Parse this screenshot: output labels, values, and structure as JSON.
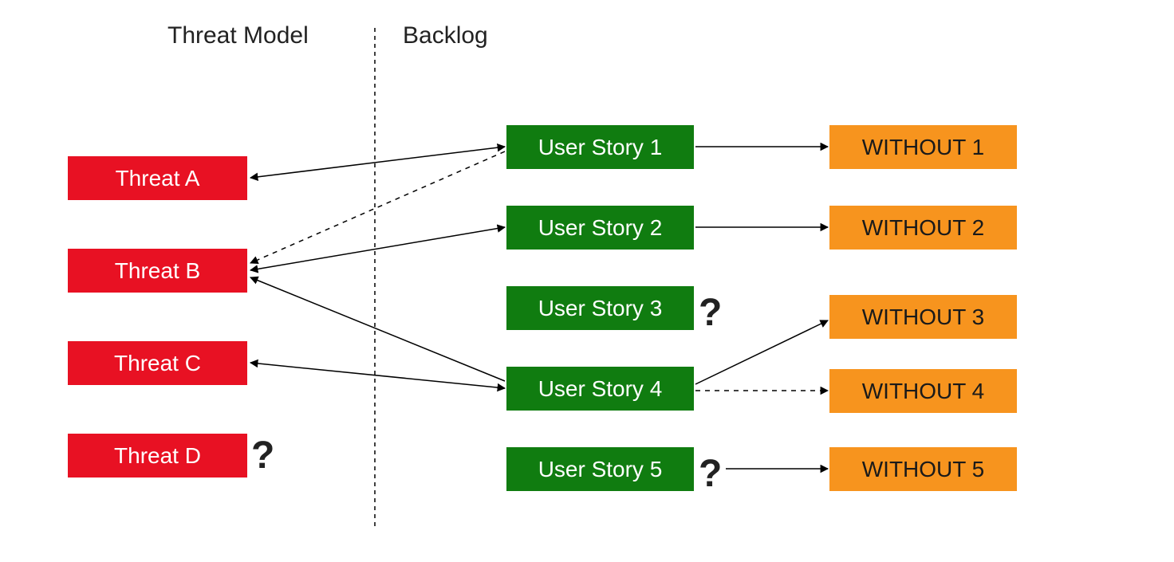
{
  "headings": {
    "threat_model": "Threat Model",
    "backlog": "Backlog"
  },
  "threats": {
    "a": "Threat A",
    "b": "Threat B",
    "c": "Threat C",
    "d": "Threat D"
  },
  "stories": {
    "s1": "User Story 1",
    "s2": "User Story 2",
    "s3": "User Story 3",
    "s4": "User Story 4",
    "s5": "User Story 5"
  },
  "withouts": {
    "w1": "WITHOUT 1",
    "w2": "WITHOUT 2",
    "w3": "WITHOUT 3",
    "w4": "WITHOUT 4",
    "w5": "WITHOUT 5"
  },
  "question_mark": "?",
  "colors": {
    "threat": "#E81123",
    "story": "#107C10",
    "without": "#F7941E"
  },
  "connections": [
    {
      "from": "story1",
      "to": "threatA",
      "style": "solid",
      "dir": "both"
    },
    {
      "from": "story1",
      "to": "threatB",
      "style": "dashed",
      "dir": "to"
    },
    {
      "from": "story2",
      "to": "threatB",
      "style": "solid",
      "dir": "both"
    },
    {
      "from": "story4",
      "to": "threatB",
      "style": "solid",
      "dir": "to"
    },
    {
      "from": "story4",
      "to": "threatC",
      "style": "solid",
      "dir": "both"
    },
    {
      "from": "story1",
      "to": "without1",
      "style": "solid",
      "dir": "to"
    },
    {
      "from": "story2",
      "to": "without2",
      "style": "solid",
      "dir": "to"
    },
    {
      "from": "story4",
      "to": "without3",
      "style": "solid",
      "dir": "to"
    },
    {
      "from": "story4",
      "to": "without4",
      "style": "dashed",
      "dir": "to"
    },
    {
      "from": "story5",
      "to": "without5",
      "style": "solid",
      "dir": "to"
    }
  ]
}
